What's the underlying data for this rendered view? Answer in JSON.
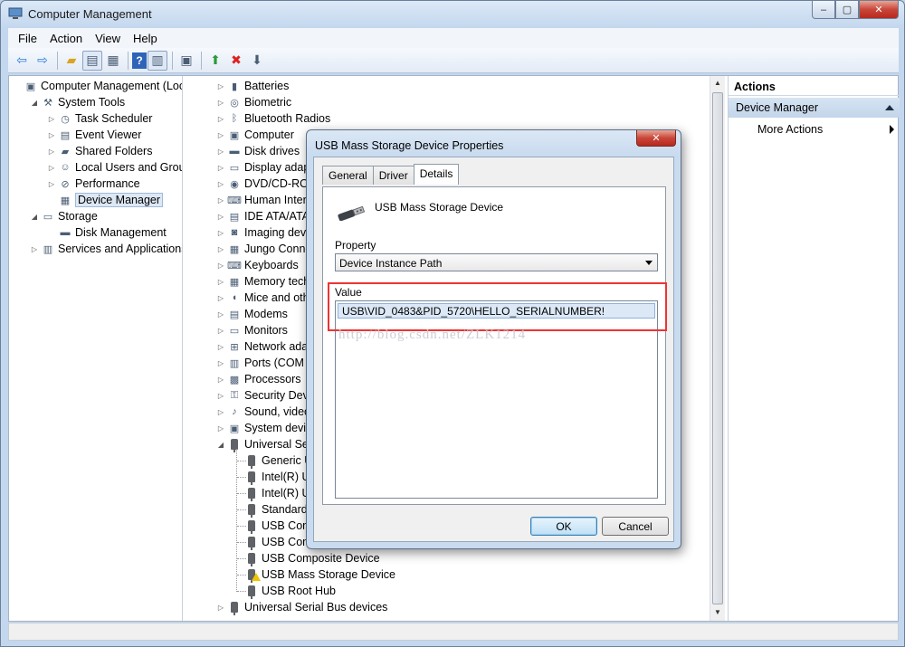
{
  "window": {
    "title": "Computer Management",
    "min": "–",
    "max": "▢",
    "close": "✕"
  },
  "menu": [
    "File",
    "Action",
    "View",
    "Help"
  ],
  "toolbar_icons": [
    "back-arrow-icon",
    "forward-arrow-icon",
    "up-folder-icon",
    "show-tree-icon",
    "properties-icon",
    "help-icon",
    "action-pane-icon",
    "scan-hardware-icon",
    "update-driver-icon",
    "uninstall-icon",
    "disable-device-icon"
  ],
  "left_tree": [
    {
      "label": "Computer Management (Local",
      "icon": "computer-management-icon",
      "level": 0,
      "expander": ""
    },
    {
      "label": "System Tools",
      "icon": "tools-icon",
      "level": 1,
      "expander": "◢"
    },
    {
      "label": "Task Scheduler",
      "icon": "clock-icon",
      "level": 2,
      "expander": "▷"
    },
    {
      "label": "Event Viewer",
      "icon": "event-viewer-icon",
      "level": 2,
      "expander": "▷"
    },
    {
      "label": "Shared Folders",
      "icon": "shared-folder-icon",
      "level": 2,
      "expander": "▷"
    },
    {
      "label": "Local Users and Groups",
      "icon": "users-icon",
      "level": 2,
      "expander": "▷"
    },
    {
      "label": "Performance",
      "icon": "performance-icon",
      "level": 2,
      "expander": "▷"
    },
    {
      "label": "Device Manager",
      "icon": "device-manager-icon",
      "level": 2,
      "expander": "",
      "selected": true
    },
    {
      "label": "Storage",
      "icon": "storage-icon",
      "level": 1,
      "expander": "◢"
    },
    {
      "label": "Disk Management",
      "icon": "disk-icon",
      "level": 2,
      "expander": ""
    },
    {
      "label": "Services and Applications",
      "icon": "services-icon",
      "level": 1,
      "expander": "▷"
    }
  ],
  "device_tree": [
    {
      "label": "Batteries",
      "icon": "battery-icon"
    },
    {
      "label": "Biometric",
      "icon": "biometric-icon"
    },
    {
      "label": "Bluetooth Radios",
      "icon": "bluetooth-icon"
    },
    {
      "label": "Computer",
      "icon": "computer-icon"
    },
    {
      "label": "Disk drives",
      "icon": "disk-drive-icon"
    },
    {
      "label": "Display adapte",
      "icon": "display-icon"
    },
    {
      "label": "DVD/CD-ROM",
      "icon": "dvd-icon"
    },
    {
      "label": "Human Interfa",
      "icon": "hid-icon"
    },
    {
      "label": "IDE ATA/ATAP",
      "icon": "ide-icon"
    },
    {
      "label": "Imaging devic",
      "icon": "camera-icon"
    },
    {
      "label": "Jungo Connec",
      "icon": "jungo-icon"
    },
    {
      "label": "Keyboards",
      "icon": "keyboard-icon"
    },
    {
      "label": "Memory techn",
      "icon": "memory-icon"
    },
    {
      "label": "Mice and othe",
      "icon": "mouse-icon"
    },
    {
      "label": "Modems",
      "icon": "modem-icon"
    },
    {
      "label": "Monitors",
      "icon": "monitor-icon"
    },
    {
      "label": "Network adap",
      "icon": "network-icon"
    },
    {
      "label": "Ports (COM &",
      "icon": "port-icon"
    },
    {
      "label": "Processors",
      "icon": "processor-icon"
    },
    {
      "label": "Security Devic",
      "icon": "security-icon"
    },
    {
      "label": "Sound, video a",
      "icon": "sound-icon"
    },
    {
      "label": "System device",
      "icon": "system-device-icon"
    },
    {
      "label": "Universal Seria",
      "icon": "usb-icon",
      "expanded": true
    }
  ],
  "usb_children": [
    {
      "label": "Generic US"
    },
    {
      "label": "Intel(R) US"
    },
    {
      "label": "Intel(R) US"
    },
    {
      "label": "Standard E"
    },
    {
      "label": "USB Comp"
    },
    {
      "label": "USB Comp"
    },
    {
      "label": "USB Composite Device"
    },
    {
      "label": "USB Mass Storage Device",
      "warning": true
    },
    {
      "label": "USB Root Hub"
    }
  ],
  "device_tree_last": {
    "label": "Universal Serial Bus devices"
  },
  "actions": {
    "header": "Actions",
    "selected": "Device Manager",
    "more": "More Actions"
  },
  "dialog": {
    "title": "USB Mass Storage Device Properties",
    "close": "✕",
    "tabs": [
      "General",
      "Driver",
      "Details"
    ],
    "active_tab": "Details",
    "device_name": "USB Mass Storage Device",
    "property_label": "Property",
    "property_value": "Device Instance Path",
    "value_label": "Value",
    "value": "USB\\VID_0483&PID_5720\\HELLO_SERIALNUMBER!",
    "watermark": "http://blog.csdn.net/ZLK1214",
    "ok": "OK",
    "cancel": "Cancel"
  }
}
